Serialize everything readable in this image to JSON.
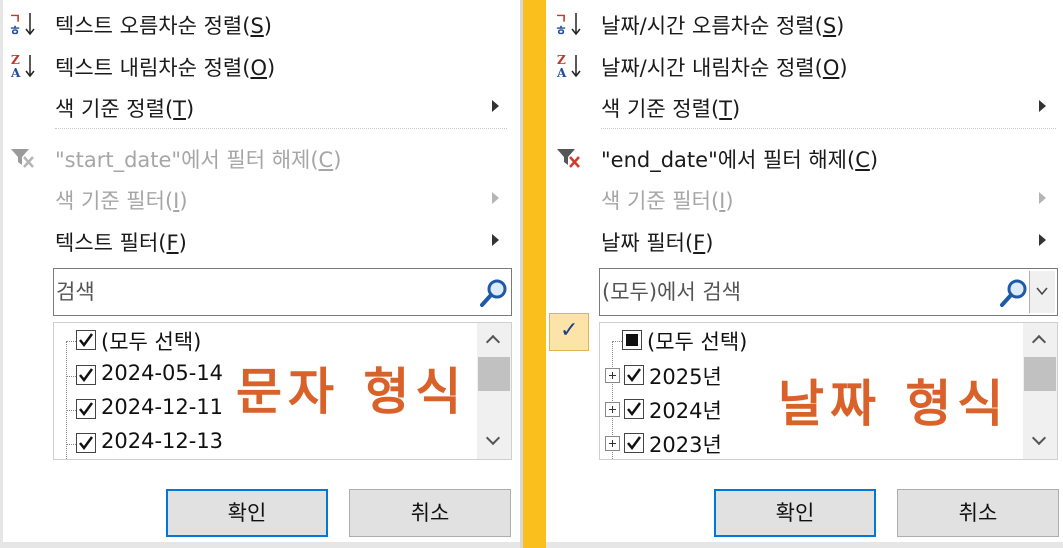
{
  "left_panel": {
    "menu": [
      {
        "label": "텍스트 오름차순 정렬(",
        "accel": "S",
        "tail": ")",
        "icon": "sort-ascending-icon",
        "enabled": true
      },
      {
        "label": "텍스트 내림차순 정렬(",
        "accel": "O",
        "tail": ")",
        "icon": "sort-descending-icon",
        "enabled": true
      },
      {
        "label": "색 기준 정렬(",
        "accel": "T",
        "tail": ")",
        "icon": "",
        "enabled": true,
        "submenu": true
      },
      {
        "label": "\"start_date\"에서 필터 해제(",
        "accel": "C",
        "tail": ")",
        "icon": "clear-filter-icon",
        "enabled": false
      },
      {
        "label": "색 기준 필터(",
        "accel": "I",
        "tail": ")",
        "icon": "",
        "enabled": false,
        "submenu": true
      },
      {
        "label": "텍스트 필터(",
        "accel": "F",
        "tail": ")",
        "icon": "",
        "enabled": true,
        "submenu": true
      }
    ],
    "search_placeholder": "검색",
    "list": [
      {
        "label": "(모두 선택)",
        "checked": true
      },
      {
        "label": "2024-05-14",
        "checked": true
      },
      {
        "label": "2024-12-11",
        "checked": true
      },
      {
        "label": "2024-12-13",
        "checked": true
      }
    ],
    "overlay": "문자 형식",
    "ok_label": "확인",
    "cancel_label": "취소"
  },
  "right_panel": {
    "menu": [
      {
        "label": "날짜/시간 오름차순 정렬(",
        "accel": "S",
        "tail": ")",
        "icon": "sort-ascending-icon",
        "enabled": true
      },
      {
        "label": "날짜/시간 내림차순 정렬(",
        "accel": "O",
        "tail": ")",
        "icon": "sort-descending-icon",
        "enabled": true
      },
      {
        "label": "색 기준 정렬(",
        "accel": "T",
        "tail": ")",
        "icon": "",
        "enabled": true,
        "submenu": true
      },
      {
        "label": "\"end_date\"에서 필터 해제(",
        "accel": "C",
        "tail": ")",
        "icon": "clear-filter-icon",
        "enabled": true
      },
      {
        "label": "색 기준 필터(",
        "accel": "I",
        "tail": ")",
        "icon": "",
        "enabled": false,
        "submenu": true
      },
      {
        "label": "날짜 필터(",
        "accel": "F",
        "tail": ")",
        "icon": "",
        "enabled": true,
        "submenu": true
      }
    ],
    "search_placeholder": "(모두)에서 검색",
    "list": [
      {
        "label": "(모두 선택)",
        "checked": "partial"
      },
      {
        "label": "2025년",
        "checked": true
      },
      {
        "label": "2024년",
        "checked": true
      },
      {
        "label": "2023년",
        "checked": true
      }
    ],
    "overlay": "날짜 형식",
    "check_mark": "✓",
    "ok_label": "확인",
    "cancel_label": "취소"
  },
  "colors": {
    "divider": "#fbbf1d",
    "overlay_text": "#d9622b",
    "primary_border": "#0078d7"
  }
}
